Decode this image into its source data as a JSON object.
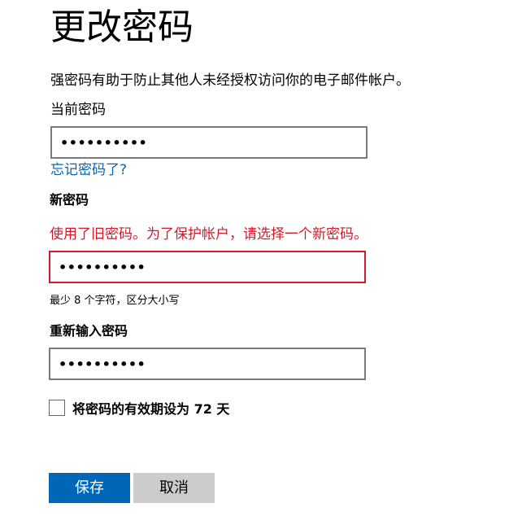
{
  "page": {
    "title": "更改密码",
    "intro": "强密码有助于防止其他人未经授权访问你的电子邮件帐户。"
  },
  "current_password": {
    "label": "当前密码",
    "value": "••••••••••",
    "forgot_link": "忘记密码了?"
  },
  "new_password": {
    "label": "新密码",
    "error": "使用了旧密码。为了保护帐户，请选择一个新密码。",
    "value": "••••••••••",
    "hint": "最少 8 个字符，区分大小写"
  },
  "reenter_password": {
    "label": "重新输入密码",
    "value": "••••••••••"
  },
  "expiry": {
    "label": "将密码的有效期设为 72 天",
    "checked": false
  },
  "actions": {
    "save_label": "保存",
    "cancel_label": "取消"
  },
  "colors": {
    "primary": "#0067b8",
    "error": "#d01b2c",
    "link": "#0a62b5",
    "secondary_button": "#cccccc"
  }
}
